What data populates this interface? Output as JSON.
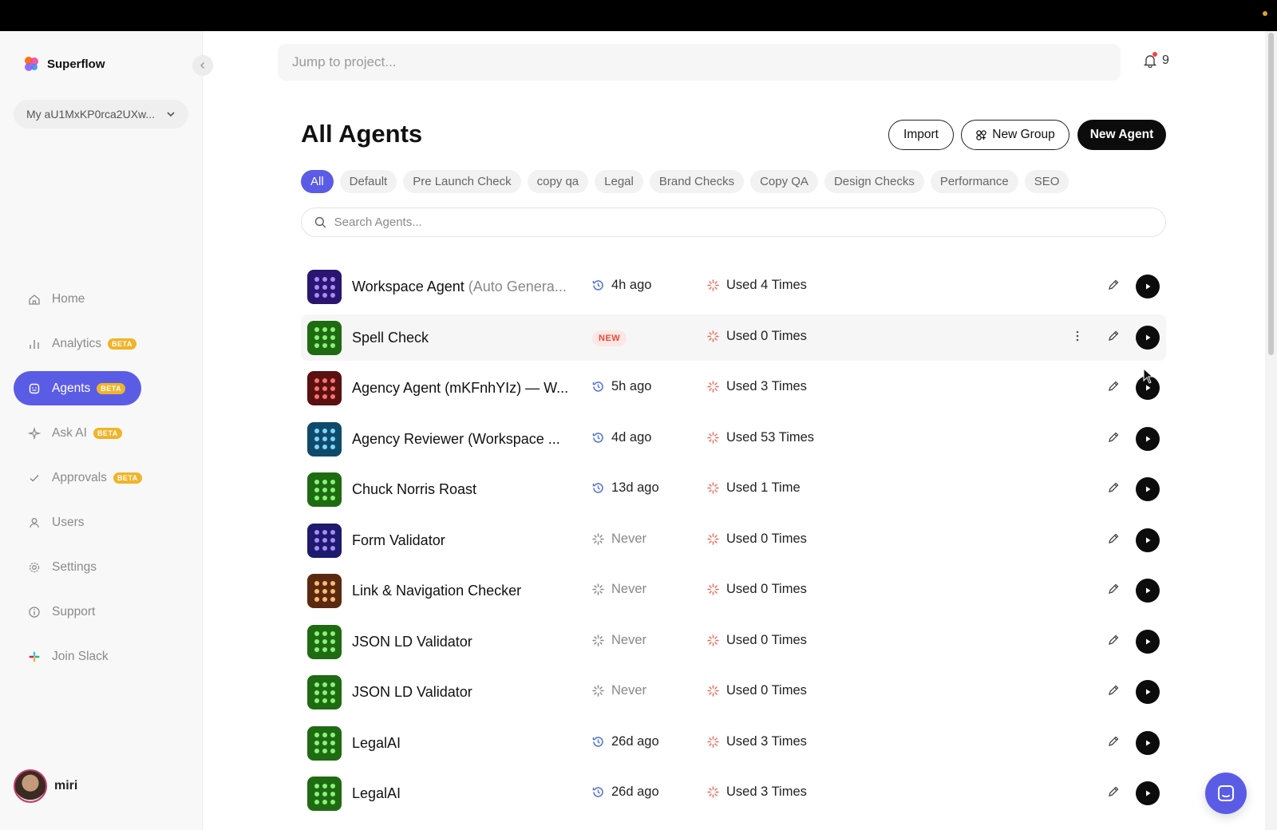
{
  "brand": {
    "name": "Superflow"
  },
  "workspace": {
    "label": "My aU1MxKP0rca2UXw..."
  },
  "sidebar": {
    "items": [
      {
        "label": "Home",
        "icon": "home-icon",
        "beta": ""
      },
      {
        "label": "Analytics",
        "icon": "bar-chart-icon",
        "beta": "BETA"
      },
      {
        "label": "Agents",
        "icon": "agent-icon",
        "beta": "BETA",
        "active": true
      },
      {
        "label": "Ask AI",
        "icon": "sparkle-icon",
        "beta": "BETA"
      },
      {
        "label": "Approvals",
        "icon": "check-icon",
        "beta": "BETA"
      },
      {
        "label": "Users",
        "icon": "user-icon",
        "beta": ""
      },
      {
        "label": "Settings",
        "icon": "gear-icon",
        "beta": ""
      },
      {
        "label": "Support",
        "icon": "info-icon",
        "beta": ""
      },
      {
        "label": "Join Slack",
        "icon": "slack-icon",
        "beta": ""
      }
    ]
  },
  "user": {
    "name": "miri"
  },
  "header": {
    "search_placeholder": "Jump to project...",
    "notifications": "9"
  },
  "page": {
    "title": "All Agents",
    "import_label": "Import",
    "new_group_label": "New Group",
    "new_agent_label": "New Agent",
    "search_placeholder": "Search Agents..."
  },
  "filters": [
    "All",
    "Default",
    "Pre Launch Check",
    "copy qa",
    "Legal",
    "Brand Checks",
    "Copy QA",
    "Design Checks",
    "Performance",
    "SEO"
  ],
  "colors": {
    "accent": "#5b5ce6",
    "beta": "#f0b429",
    "new_badge": "#e24a3b"
  },
  "agents": [
    {
      "name": "Workspace Agent",
      "suffix": " (Auto Genera...",
      "last_run": "4h ago",
      "usage": "Used 4 Times",
      "icon_bg": "#2a1570",
      "dot": "#a78bfa"
    },
    {
      "name": "Spell Check",
      "suffix": "",
      "last_run": "",
      "badge": "NEW",
      "usage": "Used 0 Times",
      "icon_bg": "#1f6b12",
      "dot": "#8bf27a",
      "hover": true
    },
    {
      "name": "Agency Agent (mKFnhYIz) — W...",
      "suffix": "",
      "last_run": "5h ago",
      "usage": "Used 3 Times",
      "icon_bg": "#5a1010",
      "dot": "#f87171"
    },
    {
      "name": "Agency Reviewer (Workspace ...",
      "suffix": "",
      "last_run": "4d ago",
      "usage": "Used 53 Times",
      "icon_bg": "#0f4a6b",
      "dot": "#7dd3fc"
    },
    {
      "name": "Chuck Norris Roast",
      "suffix": "",
      "last_run": "13d ago",
      "usage": "Used 1 Time",
      "icon_bg": "#1f6b12",
      "dot": "#8bf27a"
    },
    {
      "name": "Form Validator",
      "suffix": "",
      "last_run": "Never",
      "usage": "Used 0 Times",
      "icon_bg": "#1e1a6e",
      "dot": "#a78bfa"
    },
    {
      "name": "Link & Navigation Checker",
      "suffix": "",
      "last_run": "Never",
      "usage": "Used 0 Times",
      "icon_bg": "#5a2a10",
      "dot": "#fdba74"
    },
    {
      "name": "JSON LD Validator",
      "suffix": "",
      "last_run": "Never",
      "usage": "Used 0 Times",
      "icon_bg": "#1f6b12",
      "dot": "#8bf27a"
    },
    {
      "name": "JSON LD Validator",
      "suffix": "",
      "last_run": "Never",
      "usage": "Used 0 Times",
      "icon_bg": "#1f6b12",
      "dot": "#8bf27a"
    },
    {
      "name": "LegalAI",
      "suffix": "",
      "last_run": "26d ago",
      "usage": "Used 3 Times",
      "icon_bg": "#1f6b12",
      "dot": "#8bf27a"
    },
    {
      "name": "LegalAI",
      "suffix": "",
      "last_run": "26d ago",
      "usage": "Used 3 Times",
      "icon_bg": "#1f6b12",
      "dot": "#8bf27a"
    }
  ]
}
